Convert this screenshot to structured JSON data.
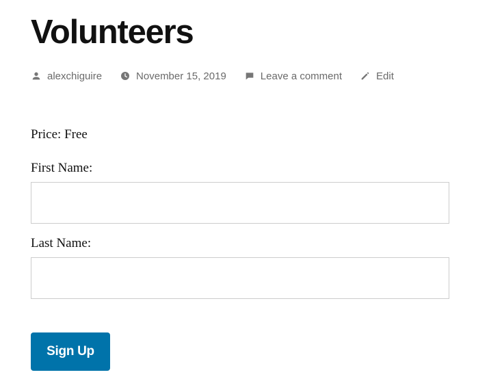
{
  "post": {
    "title": "Volunteers",
    "meta": {
      "author": {
        "icon": "person-icon",
        "text": "alexchiguire"
      },
      "date": {
        "icon": "clock-icon",
        "text": "November 15, 2019"
      },
      "comments": {
        "icon": "comment-icon",
        "text": "Leave a comment"
      },
      "edit": {
        "icon": "pencil-icon",
        "text": "Edit"
      }
    }
  },
  "form": {
    "price": "Price: Free",
    "first_name_label": "First Name:",
    "first_name_value": "",
    "last_name_label": "Last Name:",
    "last_name_value": "",
    "submit_label": "Sign Up"
  },
  "colors": {
    "button_bg": "#0073aa",
    "meta_text": "#6a6a6a",
    "input_border": "#cccccc"
  }
}
